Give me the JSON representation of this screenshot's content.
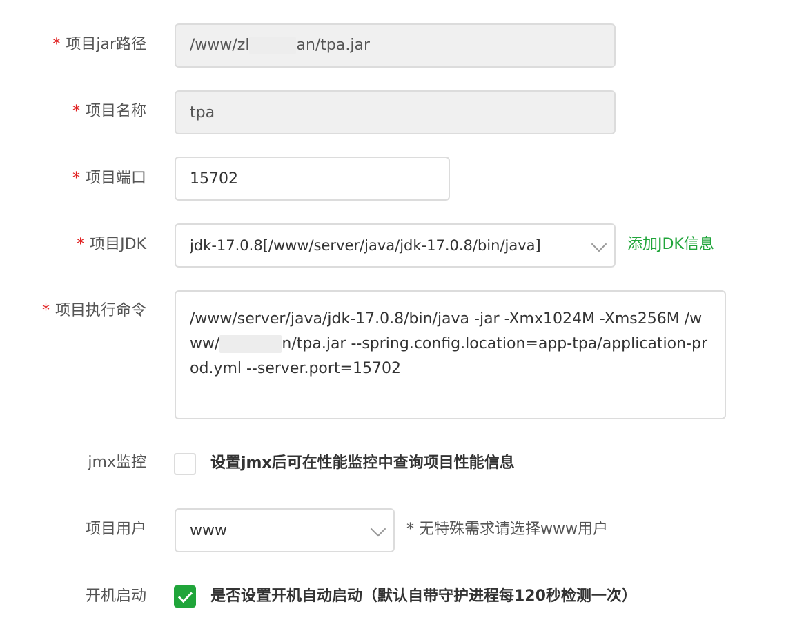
{
  "form": {
    "jar_path": {
      "label": "项目jar路径",
      "required": "*",
      "value_prefix": "/www/zl",
      "value_suffix": "an/tpa.jar"
    },
    "name": {
      "label": "项目名称",
      "required": "*",
      "value": "tpa"
    },
    "port": {
      "label": "项目端口",
      "required": "*",
      "value": "15702"
    },
    "jdk": {
      "label": "项目JDK",
      "required": "*",
      "selected": "jdk-17.0.8[/www/server/java/jdk-17.0.8/bin/java]",
      "add_link": "添加JDK信息"
    },
    "command": {
      "label": "项目执行命令",
      "required": "*",
      "value_part1": "/www/server/java/jdk-17.0.8/bin/java  -jar -Xmx1024M -Xms256M  /www/",
      "value_part2": "n/tpa.jar  --spring.config.location=app-tpa/application-prod.yml --server.port=15702"
    },
    "jmx": {
      "label": "jmx监控",
      "checked": false,
      "text": "设置jmx后可在性能监控中查询项目性能信息"
    },
    "user": {
      "label": "项目用户",
      "selected": "www",
      "hint": "* 无特殊需求请选择www用户"
    },
    "autostart": {
      "label": "开机启动",
      "checked": true,
      "text": "是否设置开机自动启动（默认自带守护进程每120秒检测一次）"
    }
  },
  "colors": {
    "accent": "#20a53a",
    "required": "#e02020",
    "disabled_bg": "#f0f0f0",
    "border": "#dcdcdc"
  }
}
